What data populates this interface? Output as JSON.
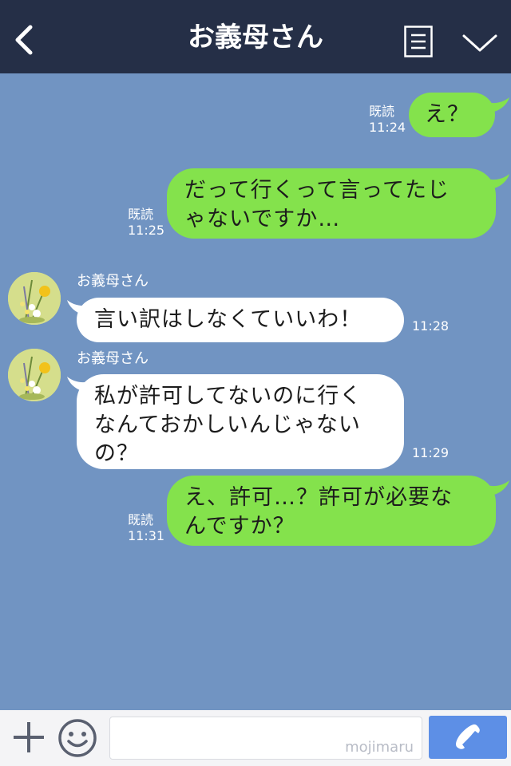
{
  "header": {
    "title": "お義母さん",
    "back_icon": "chevron-left-icon",
    "menu_icon": "menu-icon",
    "more_icon": "chevron-down-icon"
  },
  "messages": [
    {
      "direction": "out",
      "text_lines": [
        "え？"
      ],
      "read": "既読",
      "time": "11:24"
    },
    {
      "direction": "out",
      "text_lines": [
        "だって行くって言ってたじ",
        "ゃないですか…"
      ],
      "read": "既読",
      "time": "11:25"
    },
    {
      "direction": "in",
      "sender": "お義母さん",
      "text_lines": [
        "言い訳はしなくていいわ！"
      ],
      "time": "11:28"
    },
    {
      "direction": "in",
      "sender": "お義母さん",
      "text_lines": [
        "私が許可してないのに行く",
        "なんておかしいんじゃない",
        "の？"
      ],
      "time": "11:29"
    },
    {
      "direction": "out",
      "text_lines": [
        "え、許可…？許可が必要な",
        "んですか？"
      ],
      "read": "既読",
      "time": "11:31"
    }
  ],
  "footer": {
    "input_value": "",
    "watermark": "mojimaru",
    "plus_icon": "plus-icon",
    "emoji_icon": "smile-icon",
    "call_icon": "phone-icon"
  },
  "colors": {
    "background": "#7194c2",
    "header": "#252f47",
    "outgoing_bubble": "#84e24c",
    "incoming_bubble": "#ffffff",
    "call_button": "#5d8fe6"
  }
}
